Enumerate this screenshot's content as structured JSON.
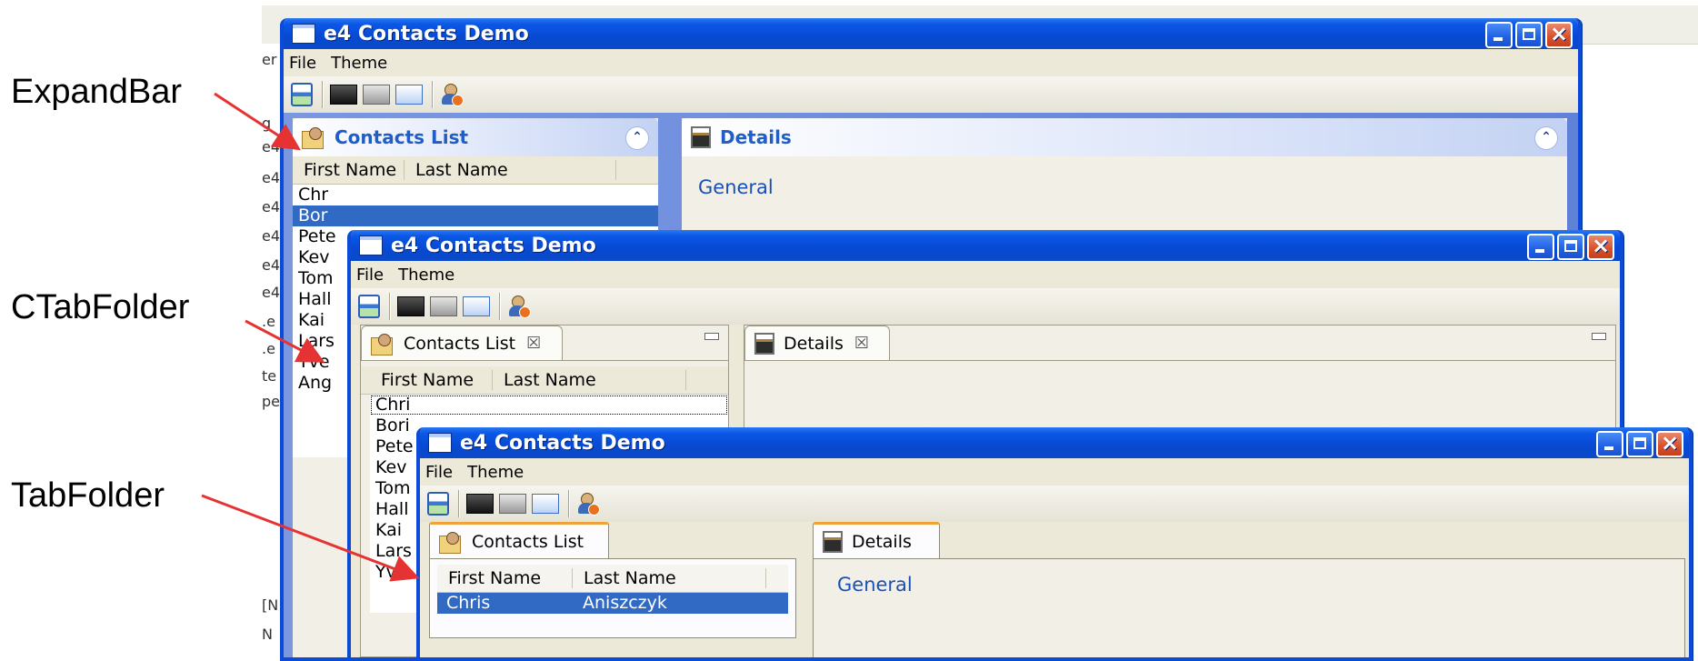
{
  "callouts": {
    "expandbar": "ExpandBar",
    "ctabfolder": "CTabFolder",
    "tabfolder": "TabFolder"
  },
  "background_fragments": [
    "er",
    "g",
    "e4",
    "e4",
    "e4",
    "e4",
    "e4",
    "e4",
    ".e",
    ".e",
    "te",
    "pe",
    "[N",
    "N"
  ],
  "windows": [
    {
      "title": "e4 Contacts Demo",
      "style": "ExpandBar",
      "menu": [
        "File",
        "Theme"
      ],
      "list_panel_title": "Contacts List",
      "details_panel_title": "Details",
      "columns": [
        "First Name",
        "Last Name"
      ],
      "rows": [
        "Chr",
        "Bor",
        "Pete",
        "Kev",
        "Tom",
        "Hall",
        "Kai",
        "Lars",
        "Yve",
        "Ang"
      ],
      "selected_row": 1,
      "details_section": "General"
    },
    {
      "title": "e4 Contacts Demo",
      "style": "CTabFolder",
      "menu": [
        "File",
        "Theme"
      ],
      "list_panel_title": "Contacts List",
      "details_panel_title": "Details",
      "columns": [
        "First Name",
        "Last Name"
      ],
      "rows": [
        "Chri",
        "Bori",
        "Pete",
        "Kev",
        "Tom",
        "Hall",
        "Kai",
        "Lars",
        "Yve"
      ]
    },
    {
      "title": "e4 Contacts Demo",
      "style": "TabFolder",
      "menu": [
        "File",
        "Theme"
      ],
      "list_panel_title": "Contacts List",
      "details_panel_title": "Details",
      "columns": [
        "First Name",
        "Last Name"
      ],
      "rows": [
        {
          "first": "Chris",
          "last": "Aniszczyk"
        }
      ],
      "selected_row": 0,
      "details_section": "General"
    }
  ],
  "icons": {
    "save": "save-icon",
    "theme_dark": "theme-dark-icon",
    "theme_gray": "theme-gray-icon",
    "theme_blue": "theme-blue-icon",
    "contact_action": "user-action-icon",
    "window": "window-icon",
    "list": "contacts-list-icon",
    "details": "details-icon",
    "collapse": "chevron-up-double-icon",
    "close_tab": "close-tab-icon",
    "minimize_panel": "minimize-panel-icon"
  },
  "colors": {
    "titlebar_blue": "#0a57e6",
    "selection_blue": "#316ac5",
    "arrow_red": "#e53333",
    "tabfolder_accent": "#f0a438",
    "expandbar_title": "#215dc6"
  }
}
